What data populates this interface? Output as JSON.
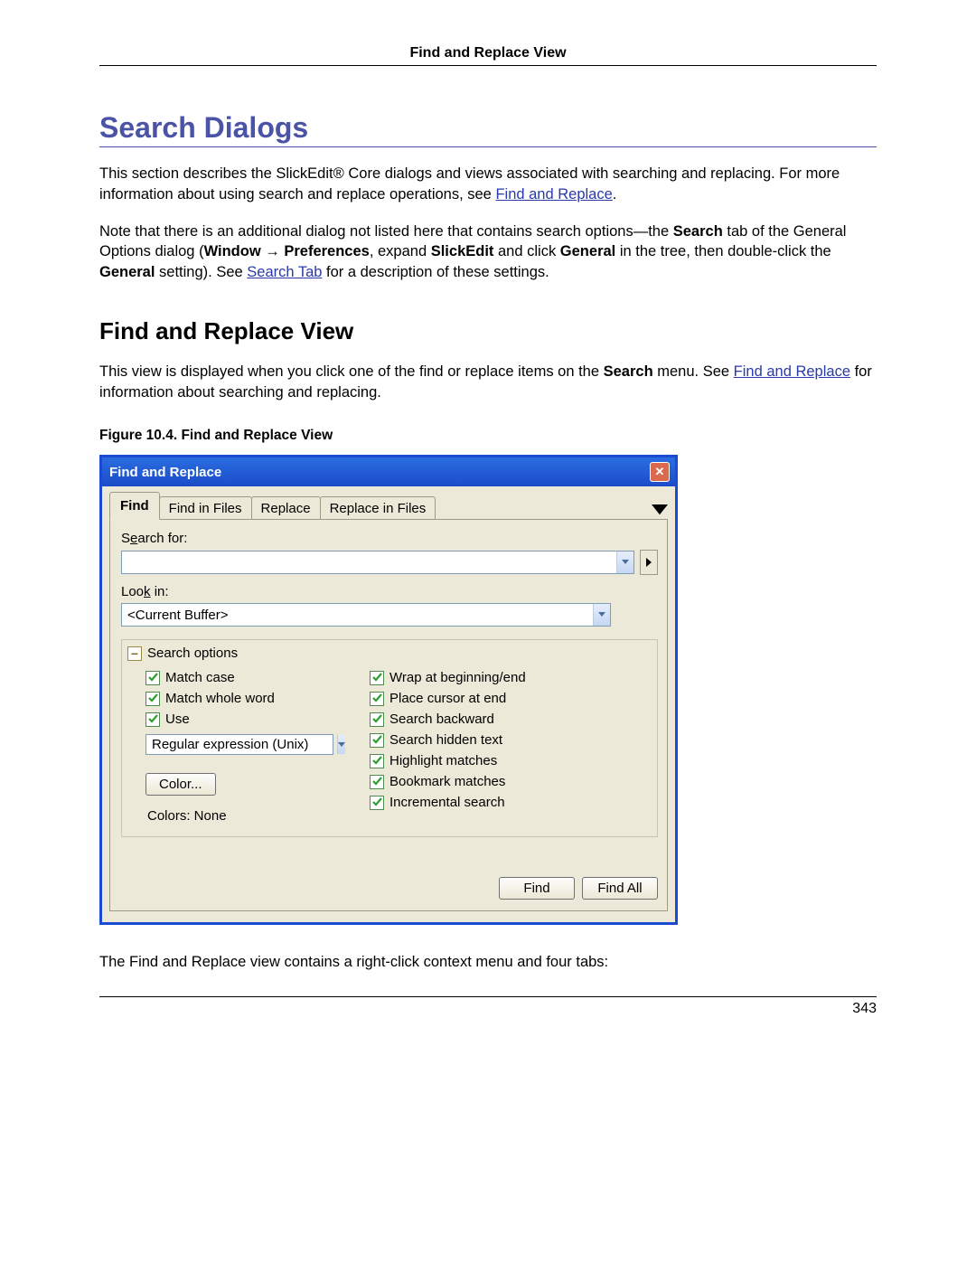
{
  "header": {
    "title": "Find and Replace View"
  },
  "h1": "Search Dialogs",
  "p1a": "This section describes the SlickEdit® Core dialogs and views associated with searching and replacing. For more information about using search and replace operations, see ",
  "link1": "Find and Replace",
  "p1b": ".",
  "p2a": "Note that there is an additional dialog not listed here that contains search options—the ",
  "p2b_bold": "Search",
  "p2c": " tab of the General Options dialog (",
  "p2d_bold": "Window",
  "p2e": " → ",
  "p2f_bold": "Preferences",
  "p2g": ", expand ",
  "p2h_bold": "SlickEdit",
  "p2i": " and click ",
  "p2j_bold": "General",
  "p2k": " in the tree, then double-click the ",
  "p2l_bold": "General",
  "p2m": " setting). See ",
  "link2": "Search Tab",
  "p2n": " for a description of these settings.",
  "h2": "Find and Replace View",
  "p3a": "This view is displayed when you click one of the find or replace items on the ",
  "p3b_bold": "Search",
  "p3c": " menu. See ",
  "link3": "Find and Replace",
  "p3d": " for information about searching and replacing.",
  "figcap": "Figure 10.4. Find and Replace View",
  "p4": "The Find and Replace view contains a right-click context menu and four tabs:",
  "pagenum": "343",
  "dialog": {
    "title": "Find and Replace",
    "tabs": [
      "Find",
      "Find in Files",
      "Replace",
      "Replace in Files"
    ],
    "search_for_label_pre": "S",
    "search_for_label_ul": "e",
    "search_for_label_post": "arch for:",
    "search_for_value": "",
    "look_in_label_pre": "Loo",
    "look_in_label_ul": "k",
    "look_in_label_post": " in:",
    "look_in_value": "<Current Buffer>",
    "group_title": "Search options",
    "left_opts": [
      "Match case",
      "Match whole word",
      "Use"
    ],
    "regex_value": "Regular expression (Unix)",
    "color_btn": "Color...",
    "colors_text": "Colors: None",
    "right_opts": [
      "Wrap at beginning/end",
      "Place cursor at end",
      "Search backward",
      "Search hidden text",
      "Highlight matches",
      "Bookmark matches",
      "Incremental search"
    ],
    "find_btn": "Find",
    "find_all_btn": "Find All"
  }
}
